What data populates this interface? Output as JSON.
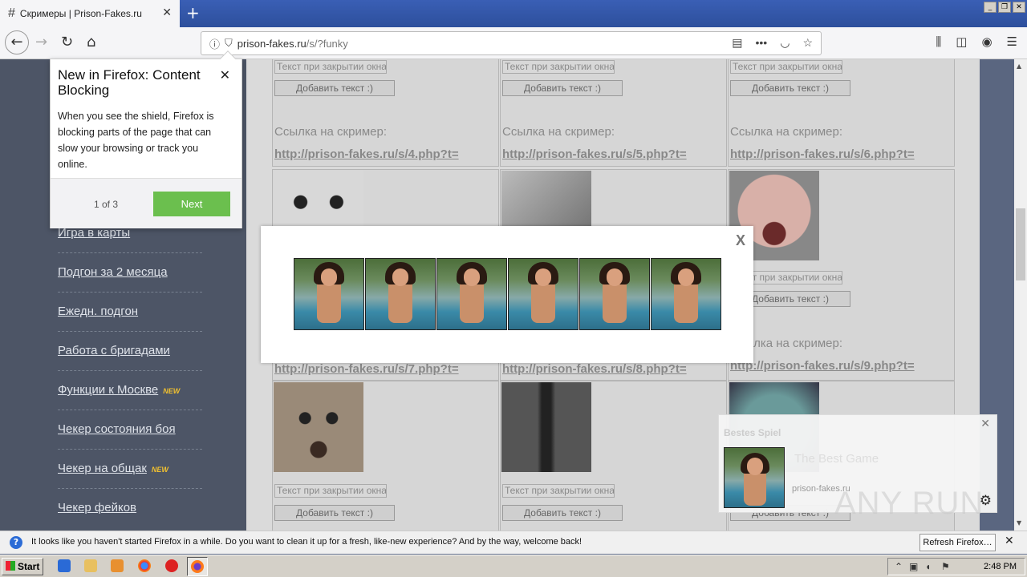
{
  "browser": {
    "tab_title": "Скримеры | Prison-Fakes.ru",
    "url_host": "prison-fakes.ru",
    "url_path": "/s/?funky"
  },
  "sidebar": {
    "items": [
      {
        "label": "Игра в карты",
        "new": false
      },
      {
        "label": "Подгон за 2 месяца",
        "new": false
      },
      {
        "label": "Ежедн. подгон",
        "new": false
      },
      {
        "label": "Работа с бригадами",
        "new": false
      },
      {
        "label": "Функции к Москве",
        "new": true
      },
      {
        "label": "Чекер состояния боя",
        "new": false
      },
      {
        "label": "Чекер на общак",
        "new": true
      },
      {
        "label": "Чекер фейков",
        "new": false
      }
    ],
    "new_badge": "NEW"
  },
  "grid": {
    "input_placeholder": "Текст при закрытии окна",
    "add_button": "Добавить текст :)",
    "link_label": "Ссылка на скример:",
    "row1_links": [
      "http://prison-fakes.ru/s/4.php?t=",
      "http://prison-fakes.ru/s/5.php?t=",
      "http://prison-fakes.ru/s/6.php?t="
    ],
    "row2_links": [
      "http://prison-fakes.ru/s/7.php?t=",
      "http://prison-fakes.ru/s/8.php?t=",
      "http://prison-fakes.ru/s/9.php?t="
    ]
  },
  "content_blocking_popup": {
    "title": "New in Firefox: Content Blocking",
    "body": "When you see the shield, Firefox is blocking parts of the page that can slow your browsing or track you online.",
    "step": "1 of 3",
    "next_label": "Next"
  },
  "modal": {
    "close_label": "X",
    "image_count": 6
  },
  "notification": {
    "title": "Bestes Spiel",
    "body": "The Best Game",
    "source": "prison-fakes.ru"
  },
  "infobar": {
    "message": "It looks like you haven't started Firefox in a while. Do you want to clean it up for a fresh, like-new experience? And by the way, welcome back!",
    "button": "Refresh Firefox…"
  },
  "taskbar": {
    "start_label": "Start",
    "clock": "2:48 PM"
  },
  "watermark": "ANY RUN"
}
